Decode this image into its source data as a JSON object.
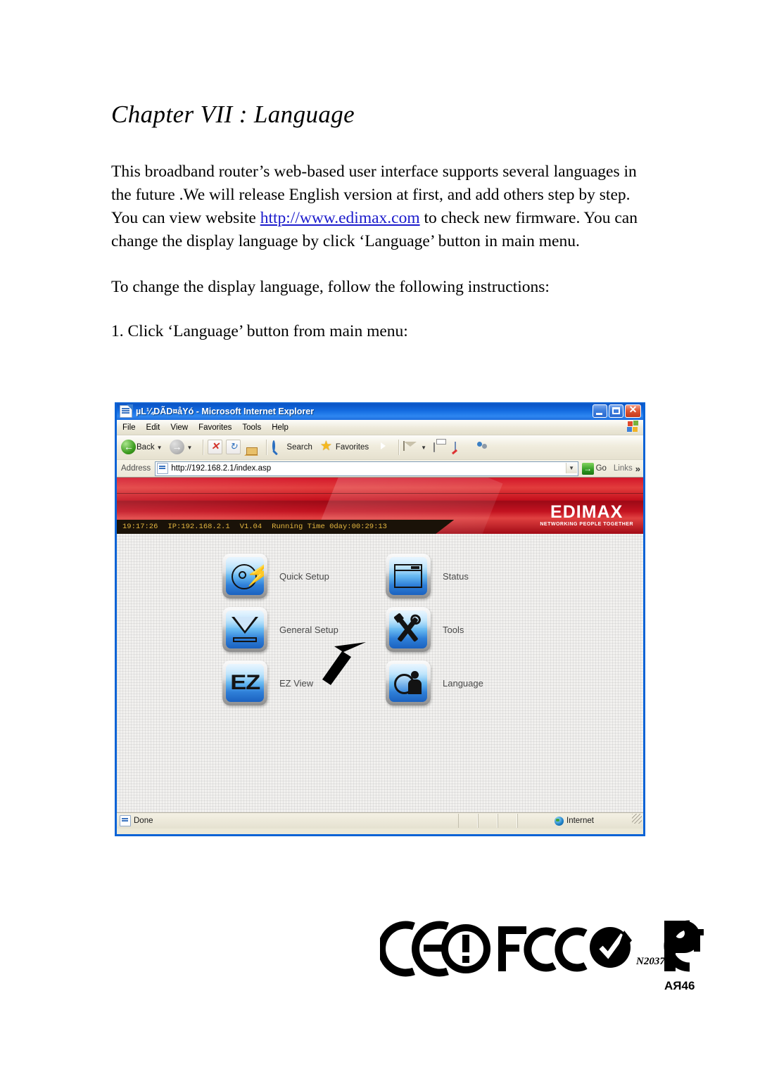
{
  "document": {
    "chapter_title": "Chapter VII : Language",
    "paragraph_1_part1": "This broadband router’s web-based user interface supports several languages in the future .We will release English version at first, and add others step by step. You can view website ",
    "paragraph_1_link": "http://www.edimax.com",
    "paragraph_1_part2": " to check new firmware. You can change the display language by click ‘Language’ button in main menu.",
    "paragraph_2": "To change the display language, follow the following instructions:",
    "step_1": "1. Click ‘Language’ button from main menu:",
    "link_color": "#1a1acc"
  },
  "browser": {
    "title": "µL¼DÃD¤åYó - Microsoft Internet Explorer",
    "window_controls": {
      "minimize": "Minimize",
      "maximize": "Maximize",
      "close": "Close"
    },
    "menu": [
      "File",
      "Edit",
      "View",
      "Favorites",
      "Tools",
      "Help"
    ],
    "toolbar": {
      "back": "Back",
      "forward": "",
      "stop": "",
      "refresh": "",
      "home": "",
      "search": "Search",
      "favorites": "Favorites",
      "media": "",
      "mail": "",
      "print": "",
      "edit": "",
      "messenger": ""
    },
    "address": {
      "label": "Address",
      "url": "http://192.168.2.1/index.asp",
      "go": "Go",
      "links": "Links",
      "more": "»"
    },
    "statusbar": {
      "status": "Done",
      "zone": "Internet"
    }
  },
  "router_ui": {
    "brand": "EDIMAX",
    "brand_tagline": "NETWORKING PEOPLE TOGETHER",
    "banner_color": "#c3121f",
    "info_bar": {
      "time": "19:17:26",
      "ip": "IP:192.168.2.1",
      "version": "V1.04",
      "running_time": "Running Time 0day:00:29:13",
      "text_color": "#e3b640"
    },
    "menu_items": [
      {
        "id": "quick-setup",
        "label": "Quick Setup",
        "icon": "lightning-disc-icon"
      },
      {
        "id": "status",
        "label": "Status",
        "icon": "window-icon"
      },
      {
        "id": "general-setup",
        "label": "General Setup",
        "icon": "funnel-icon"
      },
      {
        "id": "tools",
        "label": "Tools",
        "icon": "wrench-screwdriver-icon"
      },
      {
        "id": "ez-view",
        "label": "EZ View",
        "icon": "ez-text-icon",
        "icon_text": "EZ"
      },
      {
        "id": "language",
        "label": "Language",
        "icon": "person-globe-icon"
      }
    ],
    "annotation": {
      "type": "pointer-arrow",
      "points_to": "Language"
    }
  },
  "certifications": [
    {
      "id": "ce",
      "label": "CE"
    },
    {
      "id": "fcc",
      "label": "FC"
    },
    {
      "id": "a-tick",
      "label": "N20370"
    },
    {
      "id": "gost-r",
      "label": "АЯ46"
    }
  ]
}
